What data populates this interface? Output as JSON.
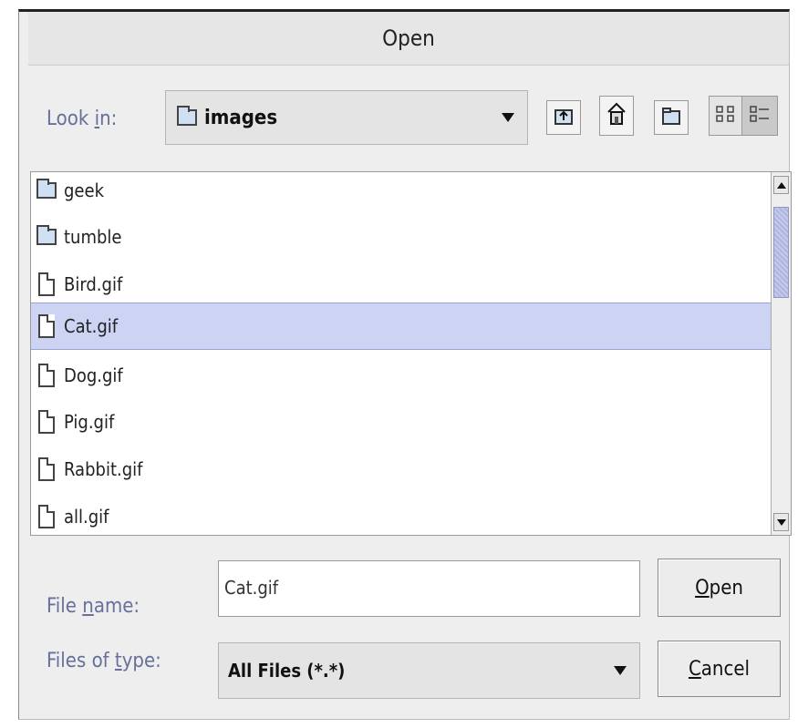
{
  "dialog": {
    "title": "Open"
  },
  "look_in": {
    "label_pre": "Look ",
    "label_mnemonic": "i",
    "label_post": "n:",
    "value": "images",
    "icon": "folder-icon"
  },
  "toolbar": {
    "buttons": [
      {
        "name": "up-folder-icon"
      },
      {
        "name": "home-icon"
      },
      {
        "name": "new-folder-icon"
      },
      {
        "name": "list-view-icon"
      },
      {
        "name": "details-view-icon"
      }
    ]
  },
  "files": [
    {
      "name": "geek",
      "type": "folder"
    },
    {
      "name": "tumble",
      "type": "folder"
    },
    {
      "name": "Bird.gif",
      "type": "file"
    },
    {
      "name": "Cat.gif",
      "type": "file",
      "selected": true
    },
    {
      "name": "Dog.gif",
      "type": "file"
    },
    {
      "name": "Pig.gif",
      "type": "file"
    },
    {
      "name": "Rabbit.gif",
      "type": "file"
    },
    {
      "name": "all.gif",
      "type": "file"
    }
  ],
  "file_name": {
    "label_pre": "File ",
    "label_mnemonic": "n",
    "label_post": "ame:",
    "value": "Cat.gif"
  },
  "files_of_type": {
    "label_pre": "Files of ",
    "label_mnemonic": "t",
    "label_post": "ype:",
    "value": "All Files (*.*)"
  },
  "buttons": {
    "open_mnemonic": "O",
    "open_rest": "pen",
    "cancel_mnemonic": "C",
    "cancel_rest": "ancel"
  },
  "colors": {
    "selection": "#cdd3f3",
    "label": "#66709a",
    "dialog_bg": "#eeeeee"
  }
}
